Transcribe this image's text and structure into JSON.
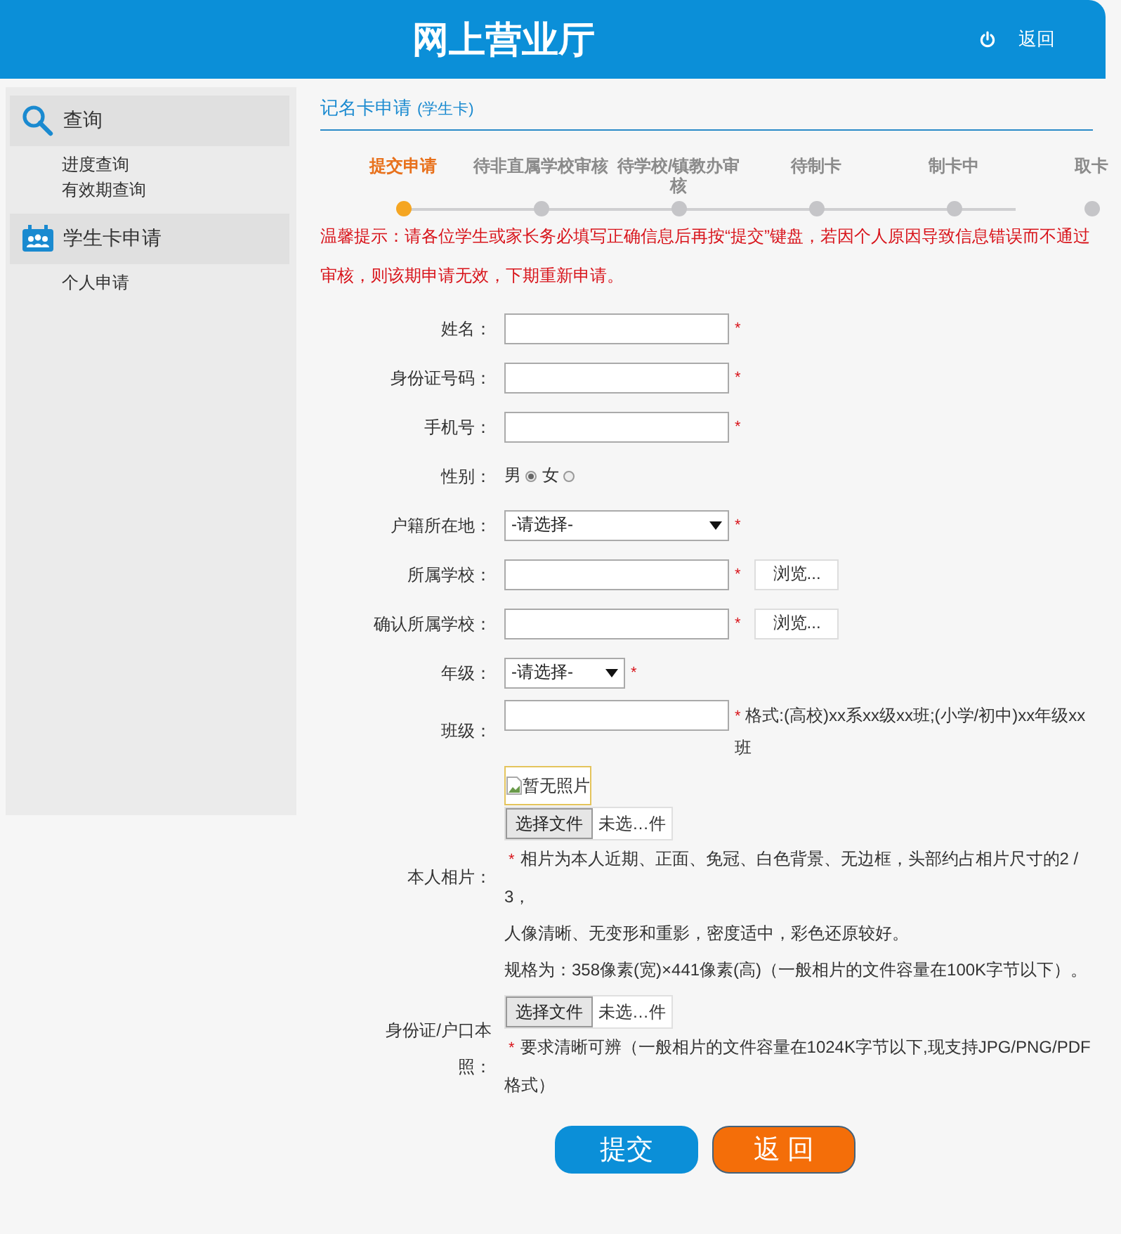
{
  "header": {
    "title": "网上营业厅",
    "back_link": "返回"
  },
  "sidebar": {
    "groups": [
      {
        "title": "查询",
        "items": [
          "进度查询",
          "有效期查询"
        ]
      },
      {
        "title": "学生卡申请",
        "items": [
          "个人申请"
        ]
      }
    ]
  },
  "page": {
    "title": "记名卡申请",
    "subtitle": "(学生卡)"
  },
  "steps": [
    {
      "label": "提交申请",
      "selected": true
    },
    {
      "label": "待非直属学校审核",
      "selected": false
    },
    {
      "label": "待学校/镇教办审核",
      "selected": false
    },
    {
      "label": "待制卡",
      "selected": false
    },
    {
      "label": "制卡中",
      "selected": false
    },
    {
      "label": "取卡",
      "selected": false
    }
  ],
  "notice": "温馨提示：请各位学生或家长务必填写正确信息后再按“提交”键盘，若因个人原因导致信息错误而不通过审核，则该期申请无效，下期重新申请。",
  "fields": [
    {
      "kind": "text",
      "label": "姓名：",
      "mark": "*"
    },
    {
      "kind": "text",
      "label": "身份证号码：",
      "mark": "*"
    },
    {
      "kind": "text",
      "label": "手机号：",
      "mark": "*"
    },
    {
      "kind": "radio",
      "label": "性别：",
      "options": [
        {
          "label": "男",
          "selected": true
        },
        {
          "label": "女",
          "selected": false
        }
      ]
    },
    {
      "kind": "select",
      "label": "户籍所在地：",
      "value": "-请选择-",
      "mark": "*"
    },
    {
      "kind": "text",
      "label": "所属学校：",
      "mark": "*",
      "button": "浏览..."
    },
    {
      "kind": "text",
      "label": "确认所属学校：",
      "mark": "*",
      "button": "浏览..."
    },
    {
      "kind": "short_select",
      "label": "年级：",
      "value": "-请选择-",
      "mark": "*"
    },
    {
      "kind": "text",
      "label": "班级：",
      "mark": "*",
      "hint": "格式:(高校)xx系xx级xx班;(小学/初中)xx年级xx班"
    },
    {
      "kind": "photo",
      "label": "本人相片：",
      "image_alt": "暂无照片",
      "file_button": "选择文件",
      "file_status": "未选…件",
      "notes": [
        {
          "mark": "*",
          "text": "相片为本人近期、正面、免冠、白色背景、无边框，头部约占相片尺寸的2 / 3，"
        },
        {
          "text": "人像清晰、无变形和重影，密度适中，彩色还原较好。"
        },
        {
          "text": "规格为：358像素(宽)×441像素(高)（一般相片的文件容量在100K字节以下）。"
        }
      ]
    },
    {
      "kind": "file",
      "label": "身份证/户口本照：",
      "file_button": "选择文件",
      "file_status": "未选…件",
      "notes": [
        {
          "mark": "*",
          "text": "要求清晰可辨（一般相片的文件容量在1024K字节以下,现支持JPG/PNG/PDF格式）"
        }
      ]
    }
  ],
  "buttons": [
    {
      "label": "提交",
      "kind": "primary"
    },
    {
      "label": "返 回",
      "kind": "secondary"
    }
  ]
}
